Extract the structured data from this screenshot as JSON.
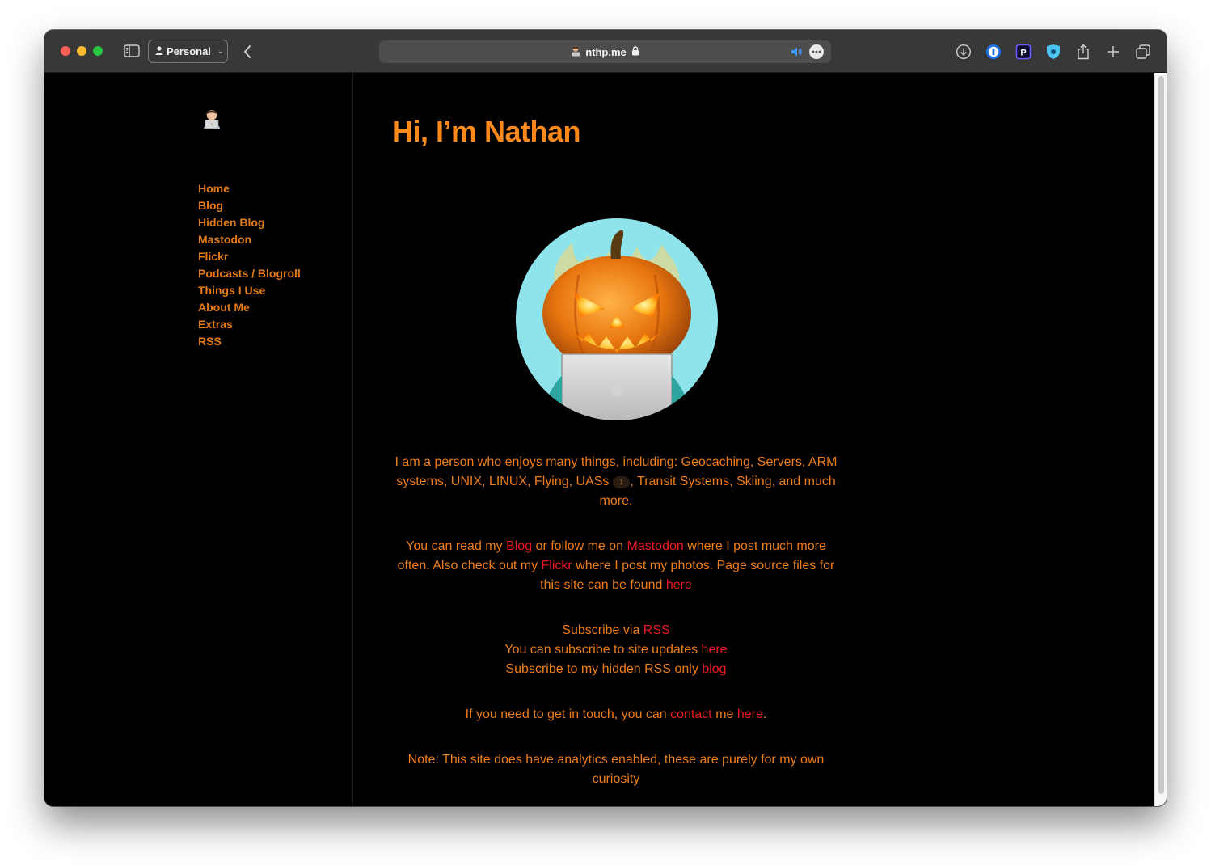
{
  "browser": {
    "profile_label": "Personal",
    "url_host": "nthp.me",
    "icons": [
      "sidebar-toggle-icon",
      "person-icon",
      "chevron-down-icon",
      "back-chevron-icon",
      "lock-icon",
      "speaker-icon",
      "ellipsis-icon",
      "download-icon",
      "password-manager-icon",
      "extension-p-icon",
      "extension-shield-icon",
      "share-icon",
      "plus-icon",
      "tabs-icon"
    ],
    "extension_p_label": "P"
  },
  "nav": {
    "items": [
      {
        "label": "Home"
      },
      {
        "label": "Blog"
      },
      {
        "label": "Hidden Blog"
      },
      {
        "label": "Mastodon"
      },
      {
        "label": "Flickr"
      },
      {
        "label": "Podcasts / Blogroll"
      },
      {
        "label": "Things I Use"
      },
      {
        "label": "About Me"
      },
      {
        "label": "Extras"
      },
      {
        "label": "RSS"
      }
    ]
  },
  "main": {
    "title": "Hi, I’m Nathan",
    "intro": {
      "before_ref": "I am a person who enjoys many things, including: Geocaching, Servers, ARM systems, UNIX, LINUX, Flying, UASs",
      "footnote_ref": "1",
      "after_ref": ", Transit Systems, Skiing, and much more."
    },
    "read": {
      "t1": "You can read my ",
      "link_blog": "Blog",
      "t2": " or follow me on ",
      "link_mastodon": "Mastodon",
      "t3": " where I post much more often. Also check out my ",
      "link_flickr": "Flickr",
      "t4": " where I post my photos. Page source files for this site can be found ",
      "link_source": "here"
    },
    "subscribe": {
      "l1_text": "Subscribe via ",
      "l1_link": "RSS",
      "l2_text": "You can subscribe to site updates ",
      "l2_link": "here",
      "l3_text": "Subscribe to my hidden RSS only ",
      "l3_link": "blog"
    },
    "contact": {
      "t1": "If you need to get in touch, you can ",
      "link_contact": "contact",
      "t2": " me ",
      "link_here": "here",
      "t3": "."
    },
    "note": "Note: This site does have analytics enabled, these are purely for my own curiosity"
  },
  "colors": {
    "accent": "#ff8a1c",
    "body_text": "#ec7d1c",
    "link": "#ea1a23",
    "background": "#000000",
    "toolbar": "#383838"
  }
}
